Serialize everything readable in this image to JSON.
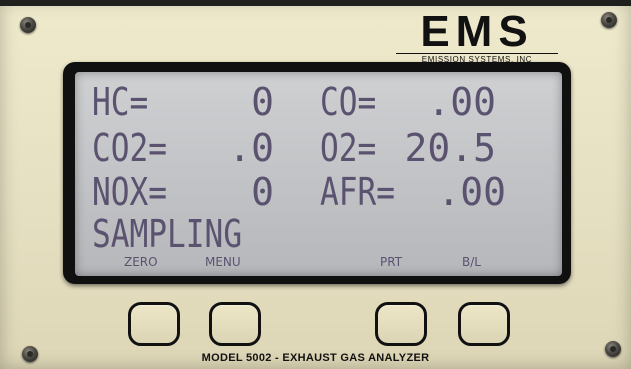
{
  "brand": {
    "logo": "EMS",
    "subtitle": "EMISSION SYSTEMS, INC"
  },
  "display": {
    "rows": [
      {
        "left_label": "HC=",
        "left_value": "0",
        "right_label": "CO=",
        "right_value": ".00"
      },
      {
        "left_label": "CO2=",
        "left_value": ".0",
        "right_label": "O2=",
        "right_value": "20.5"
      },
      {
        "left_label": "NOX=",
        "left_value": "0",
        "right_label": "AFR=",
        "right_value": ".00"
      }
    ],
    "status": "SAMPLING",
    "softkeys": [
      "ZERO",
      "MENU",
      "PRT",
      "B/L"
    ]
  },
  "footer": {
    "model": "MODEL 5002 - EXHAUST GAS ANALYZER"
  }
}
